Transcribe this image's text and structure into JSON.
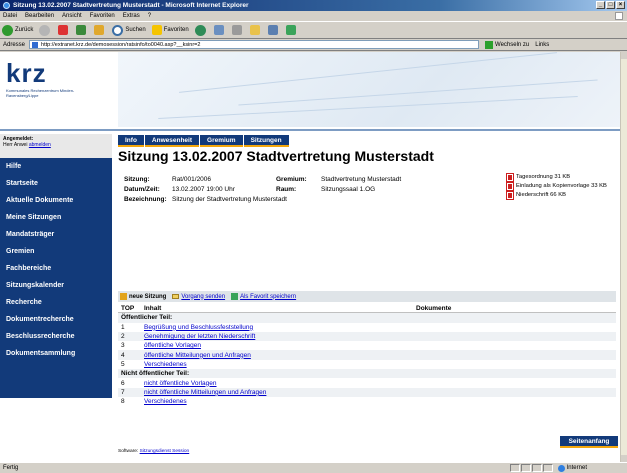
{
  "window": {
    "title": "Sitzung 13.02.2007 Stadtvertretung Musterstadt - Microsoft Internet Explorer",
    "menu": [
      "Datei",
      "Bearbeiten",
      "Ansicht",
      "Favoriten",
      "Extras",
      "?"
    ]
  },
  "toolbar": {
    "back_label": "Zurück",
    "search_label": "Suchen",
    "favorites_label": "Favoriten"
  },
  "addressbar": {
    "label": "Adresse",
    "url": "http://extranet.krz.de/demosession/ratsinfo/to0040.asp?__ksinr=2",
    "go_label": "Wechseln zu",
    "links_label": "Links"
  },
  "status": {
    "left": "Fertig",
    "zone": "Internet"
  },
  "logo": {
    "text": "krz",
    "subtitle": "Kommunales Rechenzentrum Minden-Ravensberg/Lippe"
  },
  "login": {
    "label": "Angemeldet:",
    "user": "Herr Anwei",
    "logout": "abmelden"
  },
  "nav": [
    "Hilfe",
    "Startseite",
    "Aktuelle Dokumente",
    "Meine Sitzungen",
    "Mandatsträger",
    "Gremien",
    "Fachbereiche",
    "Sitzungskalender",
    "Recherche",
    "Dokumentrecherche",
    "Beschlussrecherche",
    "Dokumentsammlung"
  ],
  "tabs": [
    "Info",
    "Anwesenheit",
    "Gremium",
    "Sitzungen"
  ],
  "page_title": "Sitzung 13.02.2007 Stadtvertretung Musterstadt",
  "info": {
    "sitzung_label": "Sitzung:",
    "sitzung": "Rat/001/2006",
    "datum_label": "Datum/Zeit:",
    "datum": "13.02.2007 19:00 Uhr",
    "bez_label": "Bezeichnung:",
    "bez": "Sitzung der Stadtvertretung Musterstadt",
    "gremium_label": "Gremium:",
    "gremium": "Stadtvertretung Musterstadt",
    "raum_label": "Raum:",
    "raum": "Sitzungssaal 1.OG"
  },
  "documents": [
    "Tagesordnung 31 KB",
    "Einladung als Kopienvorlage 33 KB",
    "Niederschrift 66 KB"
  ],
  "actions": {
    "new": "neue Sitzung",
    "send": "Vorgang senden",
    "fav": "Als Favorit speichern"
  },
  "table": {
    "col_top": "TOP",
    "col_inhalt": "Inhalt",
    "col_docs": "Dokumente",
    "public_label": "Öffentlicher Teil:",
    "public": [
      {
        "nr": "1",
        "text": "Begrüßung und Beschlussfeststellung"
      },
      {
        "nr": "2",
        "text": "Genehmigung der letzten Niederschrift"
      },
      {
        "nr": "3",
        "text": "öffentliche Vorlagen"
      },
      {
        "nr": "4",
        "text": "öffentliche Mitteilungen und Anfragen"
      },
      {
        "nr": "5",
        "text": "Verschiedenes"
      }
    ],
    "private_label": "Nicht öffentlicher Teil:",
    "private": [
      {
        "nr": "6",
        "text": "nicht öffentliche Vorlagen"
      },
      {
        "nr": "7",
        "text": "nicht öffentliche Mitteilungen und Anfragen"
      },
      {
        "nr": "8",
        "text": "Verschiedenes"
      }
    ]
  },
  "top_button": "Seitenanfang",
  "footer": {
    "label": "Software:",
    "link": "Sitzungsdienst Session"
  }
}
